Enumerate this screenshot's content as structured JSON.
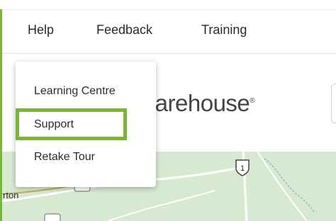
{
  "nav": {
    "help_label": "Help",
    "feedback_label": "Feedback",
    "training_label": "Training"
  },
  "brand": {
    "logo_text": "/arehouse",
    "trademark": "®"
  },
  "help_menu": {
    "items": [
      {
        "label": "Learning Centre"
      },
      {
        "label": "Support"
      },
      {
        "label": "Retake Tour"
      }
    ],
    "highlight_color": "#7bb535"
  },
  "map": {
    "route_badge": "1",
    "town_fragment": "rton"
  },
  "colors": {
    "accent": "#7bb535",
    "map_land": "#d7e9d1",
    "road": "#ffffff"
  }
}
